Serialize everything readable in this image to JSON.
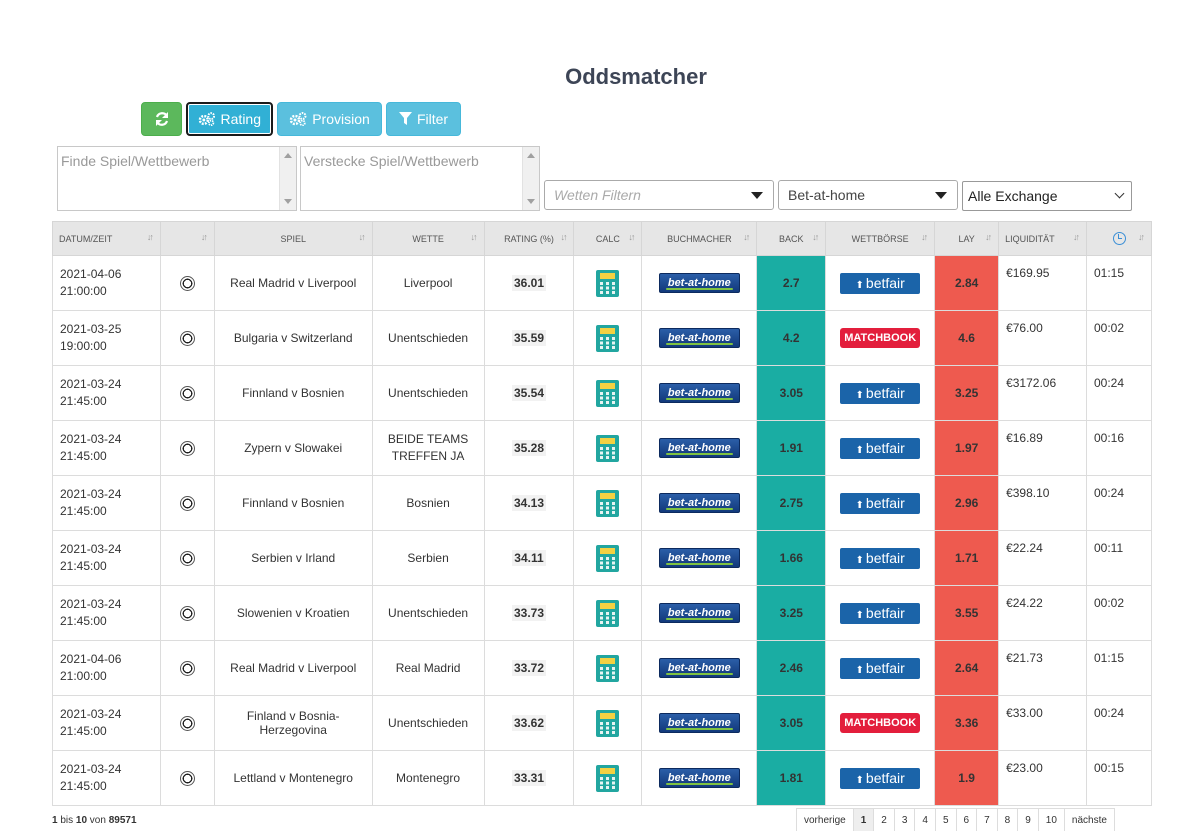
{
  "page": {
    "title": "Oddsmatcher"
  },
  "toolbar": {
    "rating_label": "Rating",
    "provision_label": "Provision",
    "filter_label": "Filter"
  },
  "filters": {
    "find_placeholder": "Finde Spiel/Wettbewerb",
    "hide_placeholder": "Verstecke Spiel/Wettbewerb",
    "bets_placeholder": "Wetten Filtern",
    "bookmaker_value": "Bet-at-home",
    "exchange_value": "Alle Exchange"
  },
  "table": {
    "headers": {
      "datum": "DATUM/ZEIT",
      "spiel": "SPIEL",
      "wette": "WETTE",
      "rating": "RATING (%)",
      "calc": "CALC",
      "buchmacher": "BUCHMACHER",
      "back": "BACK",
      "wettborse": "WETTBÖRSE",
      "lay": "LAY",
      "liquiditat": "LIQUIDITÄT"
    },
    "bookmaker_logo_text": "bet-at-home",
    "rows": [
      {
        "date": "2021-04-06",
        "time": "21:00:00",
        "match": "Real Madrid v Liverpool",
        "bet": "Liverpool",
        "rating": "36.01",
        "back": "2.7",
        "exchange": "betfair",
        "lay": "2.84",
        "liquidity": "€169.95",
        "countdown": "01:15"
      },
      {
        "date": "2021-03-25",
        "time": "19:00:00",
        "match": "Bulgaria v Switzerland",
        "bet": "Unentschieden",
        "rating": "35.59",
        "back": "4.2",
        "exchange": "MATCHBOOK",
        "lay": "4.6",
        "liquidity": "€76.00",
        "countdown": "00:02"
      },
      {
        "date": "2021-03-24",
        "time": "21:45:00",
        "match": "Finnland v Bosnien",
        "bet": "Unentschieden",
        "rating": "35.54",
        "back": "3.05",
        "exchange": "betfair",
        "lay": "3.25",
        "liquidity": "€3172.06",
        "countdown": "00:24"
      },
      {
        "date": "2021-03-24",
        "time": "21:45:00",
        "match": "Zypern v Slowakei",
        "bet": "BEIDE TEAMS TREFFEN JA",
        "rating": "35.28",
        "back": "1.91",
        "exchange": "betfair",
        "lay": "1.97",
        "liquidity": "€16.89",
        "countdown": "00:16"
      },
      {
        "date": "2021-03-24",
        "time": "21:45:00",
        "match": "Finnland v Bosnien",
        "bet": "Bosnien",
        "rating": "34.13",
        "back": "2.75",
        "exchange": "betfair",
        "lay": "2.96",
        "liquidity": "€398.10",
        "countdown": "00:24"
      },
      {
        "date": "2021-03-24",
        "time": "21:45:00",
        "match": "Serbien v Irland",
        "bet": "Serbien",
        "rating": "34.11",
        "back": "1.66",
        "exchange": "betfair",
        "lay": "1.71",
        "liquidity": "€22.24",
        "countdown": "00:11"
      },
      {
        "date": "2021-03-24",
        "time": "21:45:00",
        "match": "Slowenien v Kroatien",
        "bet": "Unentschieden",
        "rating": "33.73",
        "back": "3.25",
        "exchange": "betfair",
        "lay": "3.55",
        "liquidity": "€24.22",
        "countdown": "00:02"
      },
      {
        "date": "2021-04-06",
        "time": "21:00:00",
        "match": "Real Madrid v Liverpool",
        "bet": "Real Madrid",
        "rating": "33.72",
        "back": "2.46",
        "exchange": "betfair",
        "lay": "2.64",
        "liquidity": "€21.73",
        "countdown": "01:15"
      },
      {
        "date": "2021-03-24",
        "time": "21:45:00",
        "match": "Finland v Bosnia-Herzegovina",
        "bet": "Unentschieden",
        "rating": "33.62",
        "back": "3.05",
        "exchange": "MATCHBOOK",
        "lay": "3.36",
        "liquidity": "€33.00",
        "countdown": "00:24"
      },
      {
        "date": "2021-03-24",
        "time": "21:45:00",
        "match": "Lettland v Montenegro",
        "bet": "Montenegro",
        "rating": "33.31",
        "back": "1.81",
        "exchange": "betfair",
        "lay": "1.9",
        "liquidity": "€23.00",
        "countdown": "00:15"
      }
    ]
  },
  "footer": {
    "info_start": "1",
    "info_mid1": " bis ",
    "info_end": "10",
    "info_mid2": " von ",
    "info_total": "89571",
    "pager_prev": "vorherige",
    "pager_next": "nächste",
    "pages": [
      "1",
      "2",
      "3",
      "4",
      "5",
      "6",
      "7",
      "8",
      "9",
      "10"
    ],
    "active_page": "1"
  },
  "colors": {
    "back": "#1aada3",
    "lay": "#ee5a4f",
    "refresh": "#5cb85c",
    "info": "#5bc0de"
  },
  "icons": {
    "refresh": "refresh-icon",
    "cogs": "cogs-icon",
    "filter": "filter-icon",
    "clock": "clock-icon",
    "ball": "soccer-ball-icon",
    "calc": "calculator-icon"
  }
}
